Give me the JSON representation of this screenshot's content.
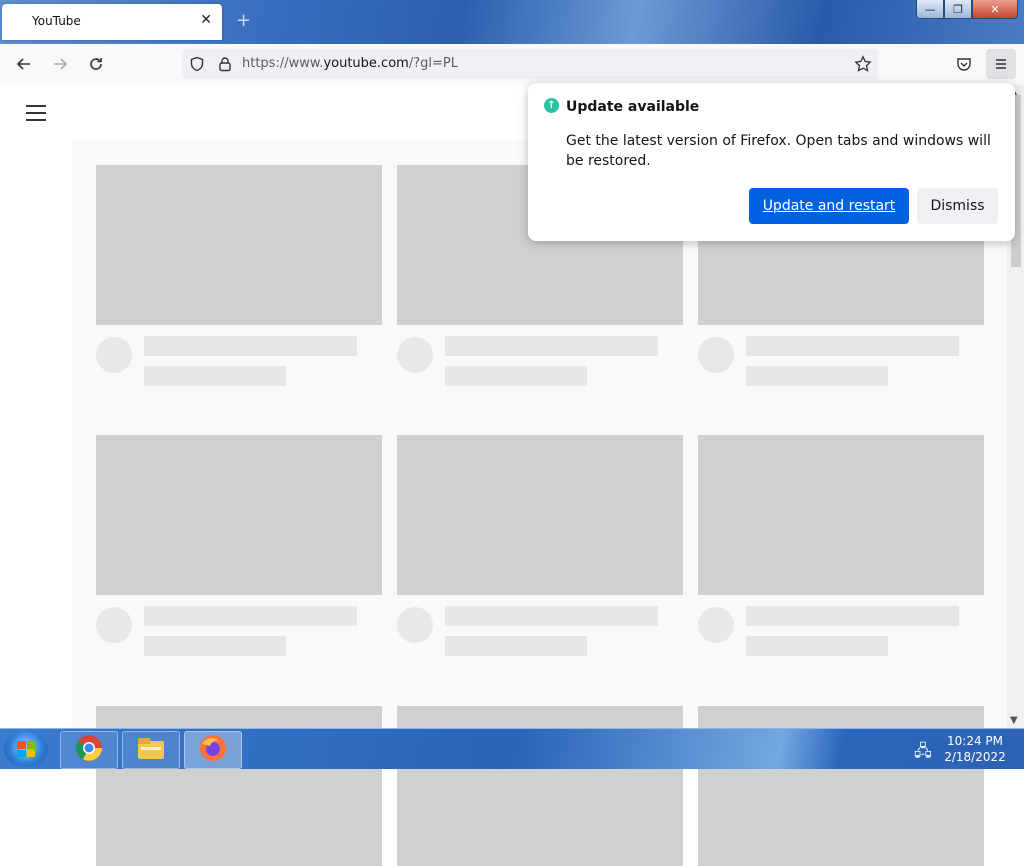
{
  "browser": {
    "tab": {
      "title": "YouTube",
      "close_glyph": "✕"
    },
    "new_tab_glyph": "+",
    "window_controls": [
      "—",
      "❐",
      "✕"
    ],
    "url": {
      "scheme": "https://www.",
      "host": "youtube.com",
      "path": "/?gl=PL"
    }
  },
  "popup": {
    "title": "Update available",
    "body": "Get the latest version of Firefox. Open tabs and windows will be restored.",
    "primary_label": "Update and restart",
    "secondary_label": "Dismiss"
  },
  "taskbar": {
    "apps": [
      "chrome-icon",
      "file-explorer-icon",
      "firefox-icon"
    ],
    "time": "10:24 PM",
    "date": "2/18/2022"
  },
  "colors": {
    "accent": "#0061e0",
    "update_badge": "#2ac3a2"
  }
}
